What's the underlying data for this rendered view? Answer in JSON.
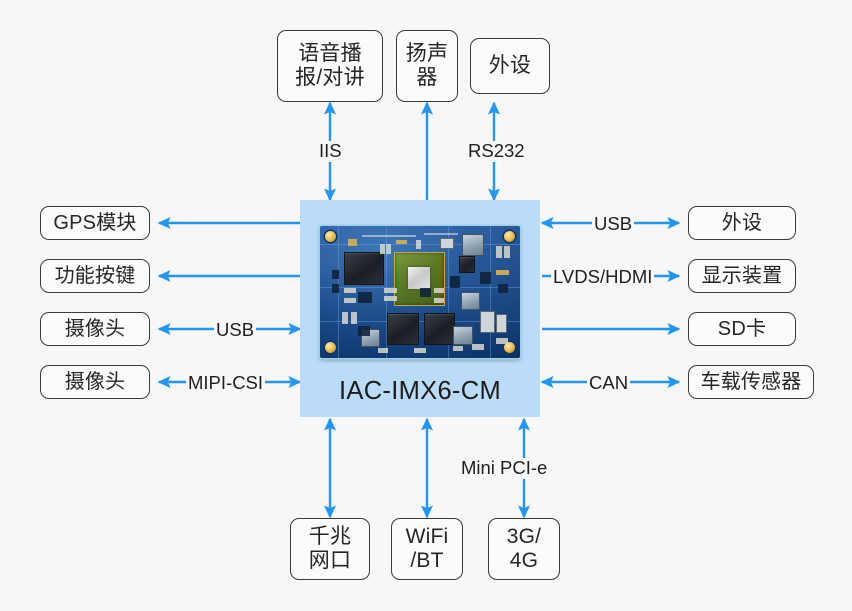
{
  "diagram": {
    "title": "IAC-IMX6-CM system block diagram",
    "background_color": "#f7f7f7",
    "module": {
      "label": "IAC-IMX6-CM",
      "fill_color": "#bbdcf8",
      "image": "pcb-photo"
    },
    "accent_color": "#2196f3",
    "node_border_color": "#3b3b3b"
  },
  "nodes": {
    "top": [
      {
        "id": "voice",
        "label": "语音播\n报/对讲"
      },
      {
        "id": "speaker",
        "label": "扬声\n器"
      },
      {
        "id": "peri_top",
        "label": "外设"
      }
    ],
    "left": [
      {
        "id": "gps",
        "label": "GPS模块"
      },
      {
        "id": "keys",
        "label": "功能按键"
      },
      {
        "id": "cam_usb",
        "label": "摄像头"
      },
      {
        "id": "cam_csi",
        "label": "摄像头"
      }
    ],
    "right": [
      {
        "id": "peri_right",
        "label": "外设"
      },
      {
        "id": "display",
        "label": "显示装置"
      },
      {
        "id": "sdcard",
        "label": "SD卡"
      },
      {
        "id": "sensor",
        "label": "车载传感器"
      }
    ],
    "bottom": [
      {
        "id": "ethernet",
        "label": "千兆\n网口"
      },
      {
        "id": "wifi",
        "label": "WiFi\n/BT"
      },
      {
        "id": "cellular",
        "label": "3G/\n4G"
      }
    ]
  },
  "edges": [
    {
      "id": "e-iis",
      "label": "IIS",
      "from": "module",
      "to": "voice",
      "direction": "both"
    },
    {
      "id": "e-speaker",
      "label": "",
      "from": "module",
      "to": "speaker",
      "direction": "up"
    },
    {
      "id": "e-rs232",
      "label": "RS232",
      "from": "module",
      "to": "peri_top",
      "direction": "both"
    },
    {
      "id": "e-gps",
      "label": "",
      "from": "module",
      "to": "gps",
      "direction": "left"
    },
    {
      "id": "e-keys",
      "label": "",
      "from": "module",
      "to": "keys",
      "direction": "left"
    },
    {
      "id": "e-cam-usb",
      "label": "USB",
      "from": "module",
      "to": "cam_usb",
      "direction": "both"
    },
    {
      "id": "e-cam-csi",
      "label": "MIPI-CSI",
      "from": "module",
      "to": "cam_csi",
      "direction": "both"
    },
    {
      "id": "e-usb-r",
      "label": "USB",
      "from": "module",
      "to": "peri_right",
      "direction": "both"
    },
    {
      "id": "e-lvds",
      "label": "LVDS/HDMI",
      "from": "module",
      "to": "display",
      "direction": "right"
    },
    {
      "id": "e-sd",
      "label": "",
      "from": "module",
      "to": "sdcard",
      "direction": "right"
    },
    {
      "id": "e-can",
      "label": "CAN",
      "from": "module",
      "to": "sensor",
      "direction": "both"
    },
    {
      "id": "e-eth",
      "label": "",
      "from": "module",
      "to": "ethernet",
      "direction": "both"
    },
    {
      "id": "e-wifi",
      "label": "",
      "from": "module",
      "to": "wifi",
      "direction": "both"
    },
    {
      "id": "e-pcie",
      "label": "Mini PCI-e",
      "from": "module",
      "to": "cellular",
      "direction": "both"
    }
  ]
}
